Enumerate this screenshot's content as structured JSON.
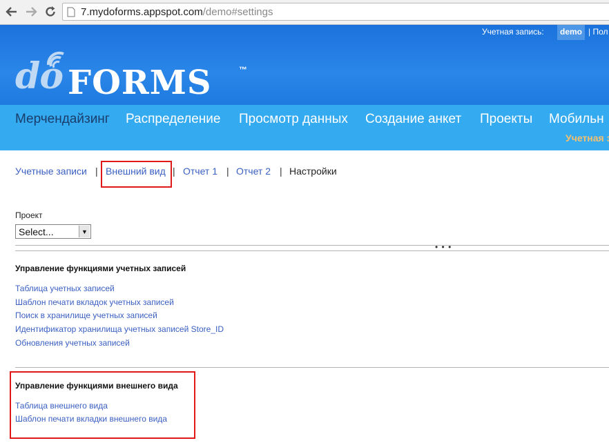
{
  "browser": {
    "url_host": "7.mydoforms.appspot.com",
    "url_path": "/demo#settings"
  },
  "header": {
    "account_label": "Учетная запись:",
    "account_user": "demo",
    "account_more": "| Пол",
    "logo_do": "do",
    "logo_forms": "FORMS",
    "logo_tm": "™"
  },
  "nav": {
    "items": [
      "Мерчендайзинг",
      "Распределение",
      "Просмотр данных",
      "Создание анкет",
      "Проекты",
      "Мобильн"
    ],
    "sub_label": "Учетная з"
  },
  "tabs": {
    "items": [
      "Учетные записи",
      "Внешний вид",
      "Отчет 1",
      "Отчет 2",
      "Настройки"
    ],
    "separator": "|"
  },
  "project": {
    "label": "Проект",
    "selected": "Select..."
  },
  "expander": "• • •",
  "sections": [
    {
      "title": "Управление функциями учетных записей",
      "links": [
        "Таблица учетных записей",
        "Шаблон печати вкладок учетных записей",
        "Поиск в хранилище учетных записей",
        "Идентификатор хранилища учетных записей Store_ID",
        "Обновления учетных записей"
      ]
    },
    {
      "title": "Управление функциями внешнего вида",
      "links": [
        "Таблица внешнего вида",
        "Шаблон печати вкладки внешнего вида"
      ]
    }
  ],
  "colors": {
    "header_blue": "#2a86e8",
    "nav_blue": "#34aaf0",
    "link_blue": "#3a5fc2",
    "highlight_red": "#e01818"
  }
}
